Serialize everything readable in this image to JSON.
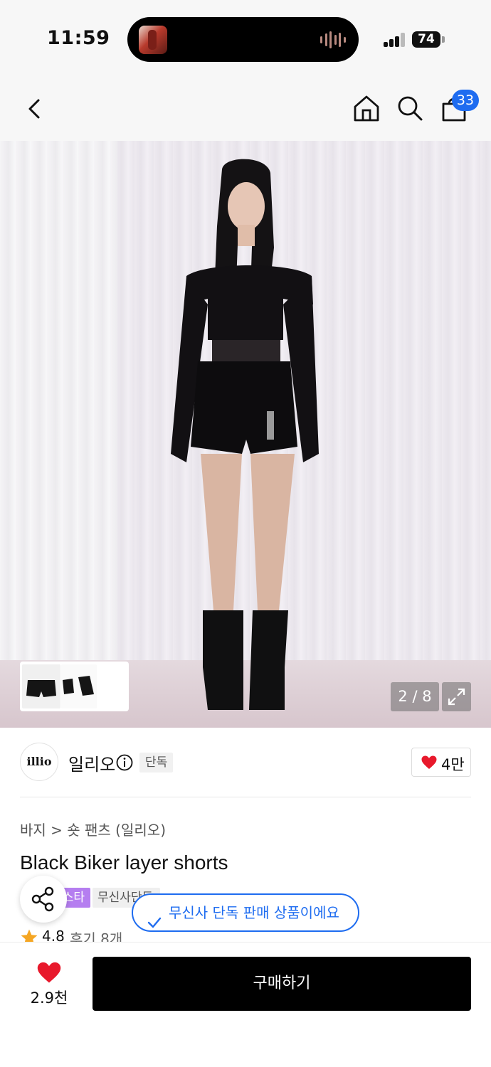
{
  "status_bar": {
    "time": "11:59",
    "battery": "74",
    "icons": [
      "now-playing-thumbnail",
      "audio-waveform-icon",
      "cellular-signal-icon",
      "battery-icon"
    ]
  },
  "nav": {
    "icons": [
      "back-chevron-icon",
      "home-icon",
      "search-icon",
      "shopping-bag-icon"
    ],
    "cart_count": "33"
  },
  "gallery": {
    "counter": "2 / 8",
    "icons": [
      "expand-icon"
    ]
  },
  "brand": {
    "logo_text": "illio",
    "name": "일리오",
    "exclusive_label": "단독",
    "like_count": "4만",
    "icons": [
      "info-icon",
      "heart-icon"
    ]
  },
  "product": {
    "breadcrumb": "바지 > 숏 팬츠 (일리오)",
    "title": "Black Biker layer shorts",
    "tags": [
      "스타",
      "무신사단독"
    ],
    "rating": "4.8",
    "reviews": "후기 8개",
    "icons": [
      "share-icon",
      "star-icon"
    ]
  },
  "toast": {
    "text": "무신사 단독 판매 상품이에요",
    "icons": [
      "check-icon"
    ]
  },
  "bottom_bar": {
    "wish_count": "2.9천",
    "buy_label": "구매하기",
    "icons": [
      "heart-filled-icon"
    ]
  },
  "colors": {
    "accent_blue": "#1e6cf0",
    "heart_red": "#e8192c",
    "star_orange": "#f5a623",
    "tag_purple": "#b57ef0",
    "buy_button": "#000000"
  }
}
